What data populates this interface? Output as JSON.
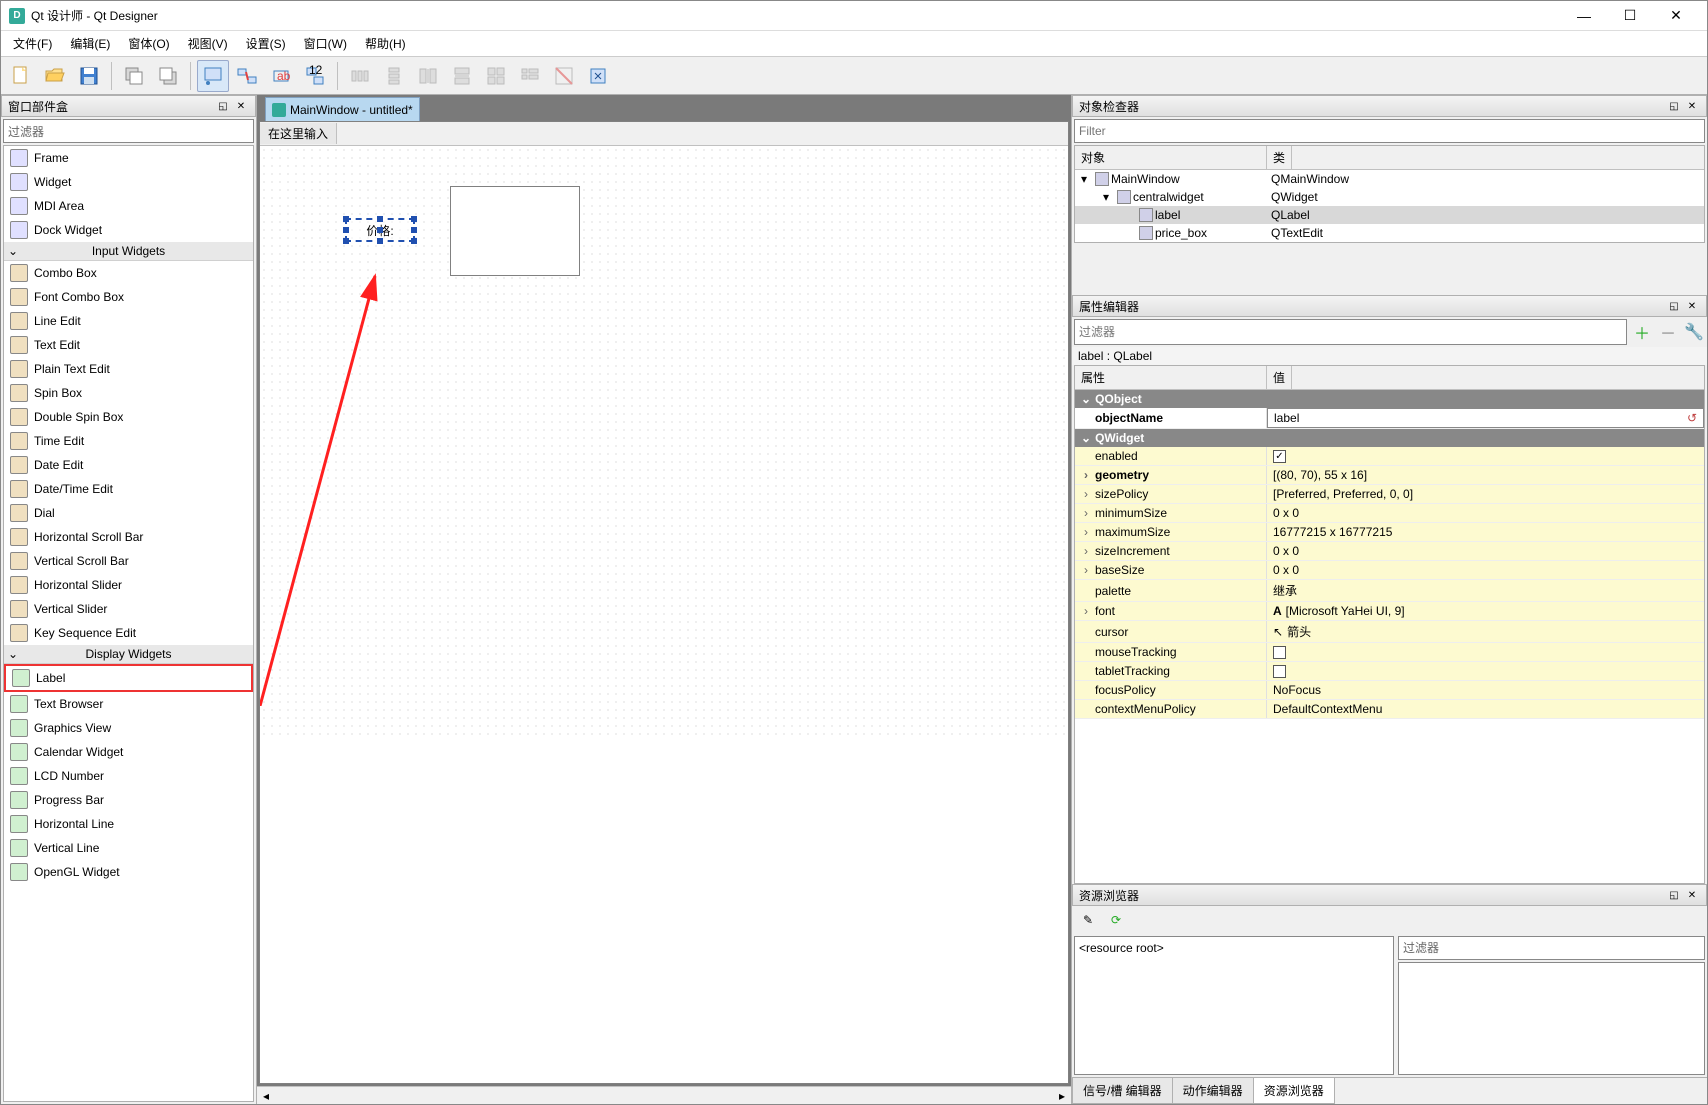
{
  "window": {
    "title": "Qt 设计师 - Qt Designer"
  },
  "menu": {
    "file": "文件(F)",
    "edit": "编辑(E)",
    "form": "窗体(O)",
    "view": "视图(V)",
    "settings": "设置(S)",
    "window": "窗口(W)",
    "help": "帮助(H)"
  },
  "widgetbox": {
    "title": "窗口部件盒",
    "filter_placeholder": "过滤器",
    "containers": [
      {
        "label": "Frame"
      },
      {
        "label": "Widget"
      },
      {
        "label": "MDI Area"
      },
      {
        "label": "Dock Widget"
      }
    ],
    "input_cat": "Input Widgets",
    "inputs": [
      {
        "label": "Combo Box"
      },
      {
        "label": "Font Combo Box"
      },
      {
        "label": "Line Edit"
      },
      {
        "label": "Text Edit"
      },
      {
        "label": "Plain Text Edit"
      },
      {
        "label": "Spin Box"
      },
      {
        "label": "Double Spin Box"
      },
      {
        "label": "Time Edit"
      },
      {
        "label": "Date Edit"
      },
      {
        "label": "Date/Time Edit"
      },
      {
        "label": "Dial"
      },
      {
        "label": "Horizontal Scroll Bar"
      },
      {
        "label": "Vertical Scroll Bar"
      },
      {
        "label": "Horizontal Slider"
      },
      {
        "label": "Vertical Slider"
      },
      {
        "label": "Key Sequence Edit"
      }
    ],
    "display_cat": "Display Widgets",
    "displays": [
      {
        "label": "Label",
        "highlight": true
      },
      {
        "label": "Text Browser"
      },
      {
        "label": "Graphics View"
      },
      {
        "label": "Calendar Widget"
      },
      {
        "label": "LCD Number"
      },
      {
        "label": "Progress Bar"
      },
      {
        "label": "Horizontal Line"
      },
      {
        "label": "Vertical Line"
      },
      {
        "label": "OpenGL Widget"
      }
    ]
  },
  "form": {
    "tab_title": "MainWindow - untitled*",
    "prompt": "在这里输入",
    "label_text": "价格:"
  },
  "inspector": {
    "title": "对象检查器",
    "filter_placeholder": "Filter",
    "col_object": "对象",
    "col_class": "类",
    "rows": [
      {
        "name": "MainWindow",
        "cls": "QMainWindow",
        "indent": 1,
        "expand": "▾"
      },
      {
        "name": "centralwidget",
        "cls": "QWidget",
        "indent": 2,
        "expand": "▾"
      },
      {
        "name": "label",
        "cls": "QLabel",
        "indent": 3,
        "sel": true
      },
      {
        "name": "price_box",
        "cls": "QTextEdit",
        "indent": 3
      }
    ]
  },
  "props": {
    "title": "属性编辑器",
    "filter_placeholder": "过滤器",
    "crumb": "label : QLabel",
    "col_prop": "属性",
    "col_val": "值",
    "groups": [
      {
        "name": "QObject",
        "rows": [
          {
            "name": "objectName",
            "value": "label",
            "bold": true,
            "edit": true
          }
        ]
      },
      {
        "name": "QWidget",
        "rows": [
          {
            "name": "enabled",
            "value": "",
            "check": true,
            "checked": true,
            "yel": true
          },
          {
            "name": "geometry",
            "value": "[(80, 70), 55 x 16]",
            "exp": true,
            "bold": true,
            "yel": true
          },
          {
            "name": "sizePolicy",
            "value": "[Preferred, Preferred, 0, 0]",
            "exp": true,
            "yel": true
          },
          {
            "name": "minimumSize",
            "value": "0 x 0",
            "exp": true,
            "yel": true
          },
          {
            "name": "maximumSize",
            "value": "16777215 x 16777215",
            "exp": true,
            "yel": true
          },
          {
            "name": "sizeIncrement",
            "value": "0 x 0",
            "exp": true,
            "yel": true
          },
          {
            "name": "baseSize",
            "value": "0 x 0",
            "exp": true,
            "yel": true
          },
          {
            "name": "palette",
            "value": "继承",
            "yel": true
          },
          {
            "name": "font",
            "value": "[Microsoft YaHei UI, 9]",
            "exp": true,
            "yel": true,
            "fonticon": true
          },
          {
            "name": "cursor",
            "value": "箭头",
            "yel": true,
            "cursoricon": true
          },
          {
            "name": "mouseTracking",
            "value": "",
            "check": true,
            "checked": false,
            "yel": true
          },
          {
            "name": "tabletTracking",
            "value": "",
            "check": true,
            "checked": false,
            "yel": true
          },
          {
            "name": "focusPolicy",
            "value": "NoFocus",
            "yel": true
          },
          {
            "name": "contextMenuPolicy",
            "value": "DefaultContextMenu",
            "yel": true
          }
        ]
      }
    ]
  },
  "resource": {
    "title": "资源浏览器",
    "filter_placeholder": "过滤器",
    "root": "<resource root>",
    "tabs": {
      "signals": "信号/槽 编辑器",
      "actions": "动作编辑器",
      "resources": "资源浏览器"
    }
  }
}
